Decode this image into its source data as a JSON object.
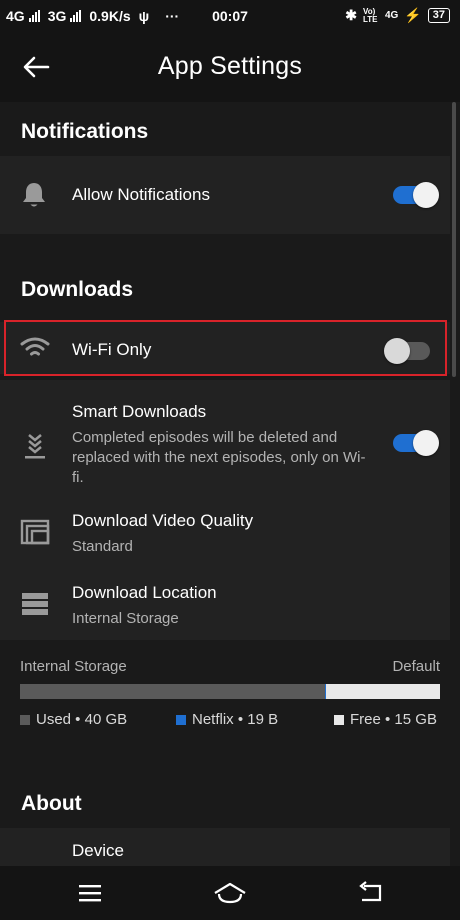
{
  "status_bar": {
    "network1": "4G",
    "network2": "3G",
    "speed": "0.9K/s",
    "usb": "ψ",
    "more": "···",
    "time": "00:07",
    "bluetooth": "✱",
    "volte": "Vo) LTE",
    "network3": "4G",
    "battery": "37"
  },
  "header": {
    "title": "App Settings",
    "back_icon": "arrow-left-icon"
  },
  "notifications": {
    "title": "Notifications",
    "allow": {
      "label": "Allow Notifications",
      "icon": "bell-icon",
      "enabled": true
    }
  },
  "downloads": {
    "title": "Downloads",
    "wifi_only": {
      "label": "Wi-Fi Only",
      "icon": "wifi-icon",
      "enabled": false
    },
    "smart_downloads": {
      "label": "Smart Downloads",
      "description": "Completed episodes will be deleted and replaced with the next episodes, only on Wi-fi.",
      "icon": "smart-downloads-icon",
      "enabled": true
    },
    "video_quality": {
      "label": "Download Video Quality",
      "value": "Standard",
      "icon": "video-quality-icon"
    },
    "location": {
      "label": "Download Location",
      "value": "Internal Storage",
      "icon": "storage-icon"
    }
  },
  "storage": {
    "label": "Internal Storage",
    "value": "Default",
    "used": {
      "label": "Used • 40 GB",
      "gb": 40,
      "color": "#5a5a5a"
    },
    "netflix": {
      "label": "Netflix • 19 B",
      "color": "#1f6fd1"
    },
    "free": {
      "label": "Free • 15 GB",
      "gb": 15,
      "color": "#e8e8e8"
    }
  },
  "about": {
    "title": "About",
    "device": {
      "label": "Device"
    }
  },
  "nav_bar": {
    "menu_icon": "menu-icon",
    "home_icon": "home-icon",
    "back_icon": "back-return-icon"
  },
  "colors": {
    "accent": "#1f6fd1",
    "highlight_border": "#d8232a",
    "background": "#1a1a1a"
  }
}
